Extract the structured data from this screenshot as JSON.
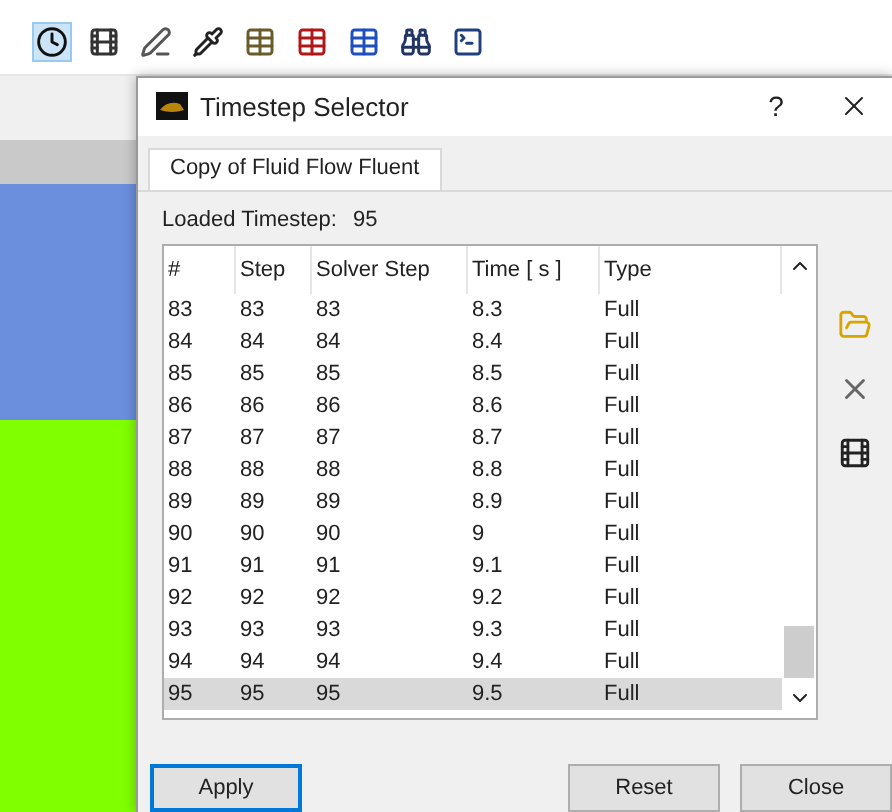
{
  "toolbar": {
    "buttons": [
      {
        "selected": true
      },
      {
        "selected": false
      },
      {
        "selected": false
      },
      {
        "selected": false
      },
      {
        "selected": false
      },
      {
        "selected": false
      },
      {
        "selected": false
      },
      {
        "selected": false
      },
      {
        "selected": false
      }
    ]
  },
  "dialog": {
    "title": "Timestep Selector",
    "help": "?",
    "tabs": [
      {
        "label": "Copy of Fluid Flow Fluent",
        "selected": true
      }
    ],
    "loaded_label": "Loaded Timestep:",
    "loaded_value": "95",
    "table": {
      "columns": [
        "#",
        "Step",
        "Solver Step",
        "Time [ s ]",
        "Type"
      ],
      "rows": [
        {
          "cells": [
            "83",
            "83",
            "83",
            "8.3",
            "Full"
          ],
          "selected": false
        },
        {
          "cells": [
            "84",
            "84",
            "84",
            "8.4",
            "Full"
          ],
          "selected": false
        },
        {
          "cells": [
            "85",
            "85",
            "85",
            "8.5",
            "Full"
          ],
          "selected": false
        },
        {
          "cells": [
            "86",
            "86",
            "86",
            "8.6",
            "Full"
          ],
          "selected": false
        },
        {
          "cells": [
            "87",
            "87",
            "87",
            "8.7",
            "Full"
          ],
          "selected": false
        },
        {
          "cells": [
            "88",
            "88",
            "88",
            "8.8",
            "Full"
          ],
          "selected": false
        },
        {
          "cells": [
            "89",
            "89",
            "89",
            "8.9",
            "Full"
          ],
          "selected": false
        },
        {
          "cells": [
            "90",
            "90",
            "90",
            "9",
            "Full"
          ],
          "selected": false
        },
        {
          "cells": [
            "91",
            "91",
            "91",
            "9.1",
            "Full"
          ],
          "selected": false
        },
        {
          "cells": [
            "92",
            "92",
            "92",
            "9.2",
            "Full"
          ],
          "selected": false
        },
        {
          "cells": [
            "93",
            "93",
            "93",
            "9.3",
            "Full"
          ],
          "selected": false
        },
        {
          "cells": [
            "94",
            "94",
            "94",
            "9.4",
            "Full"
          ],
          "selected": false
        },
        {
          "cells": [
            "95",
            "95",
            "95",
            "9.5",
            "Full"
          ],
          "selected": true
        }
      ]
    },
    "buttons": [
      {
        "label": "Apply",
        "kind": "default"
      },
      {
        "label": "Reset",
        "kind": "normal"
      },
      {
        "label": "Close",
        "kind": "normal"
      }
    ]
  }
}
